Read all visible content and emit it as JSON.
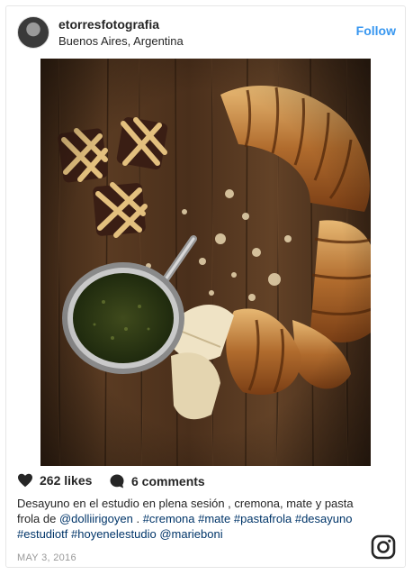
{
  "post": {
    "username": "etorresfotografia",
    "location": "Buenos Aires, Argentina",
    "follow_label": "Follow",
    "likes": "262 likes",
    "comments": "6 comments",
    "caption_parts": [
      {
        "text": "Desayuno en el estudio en plena sesión , cremona, mate y pasta frola de ",
        "tag": false
      },
      {
        "text": "@dolliirigoyen",
        "tag": true
      },
      {
        "text": " . ",
        "tag": false
      },
      {
        "text": "#cremona",
        "tag": true
      },
      {
        "text": " ",
        "tag": false
      },
      {
        "text": "#mate",
        "tag": true
      },
      {
        "text": " ",
        "tag": false
      },
      {
        "text": "#pastafrola",
        "tag": true
      },
      {
        "text": " ",
        "tag": false
      },
      {
        "text": "#desayuno",
        "tag": true
      },
      {
        "text": " ",
        "tag": false
      },
      {
        "text": "#estudiotf",
        "tag": true
      },
      {
        "text": " ",
        "tag": false
      },
      {
        "text": "#hoyenelestudio",
        "tag": true
      },
      {
        "text": " ",
        "tag": false
      },
      {
        "text": "@marieboni",
        "tag": true
      }
    ],
    "date": "MAY 3, 2016"
  },
  "icons": {
    "heart": "heart-icon",
    "comment": "comment-icon",
    "instagram": "instagram-logo-icon"
  },
  "colors": {
    "link": "#3897f0",
    "tag": "#003569",
    "wood": "#5a3b22"
  }
}
